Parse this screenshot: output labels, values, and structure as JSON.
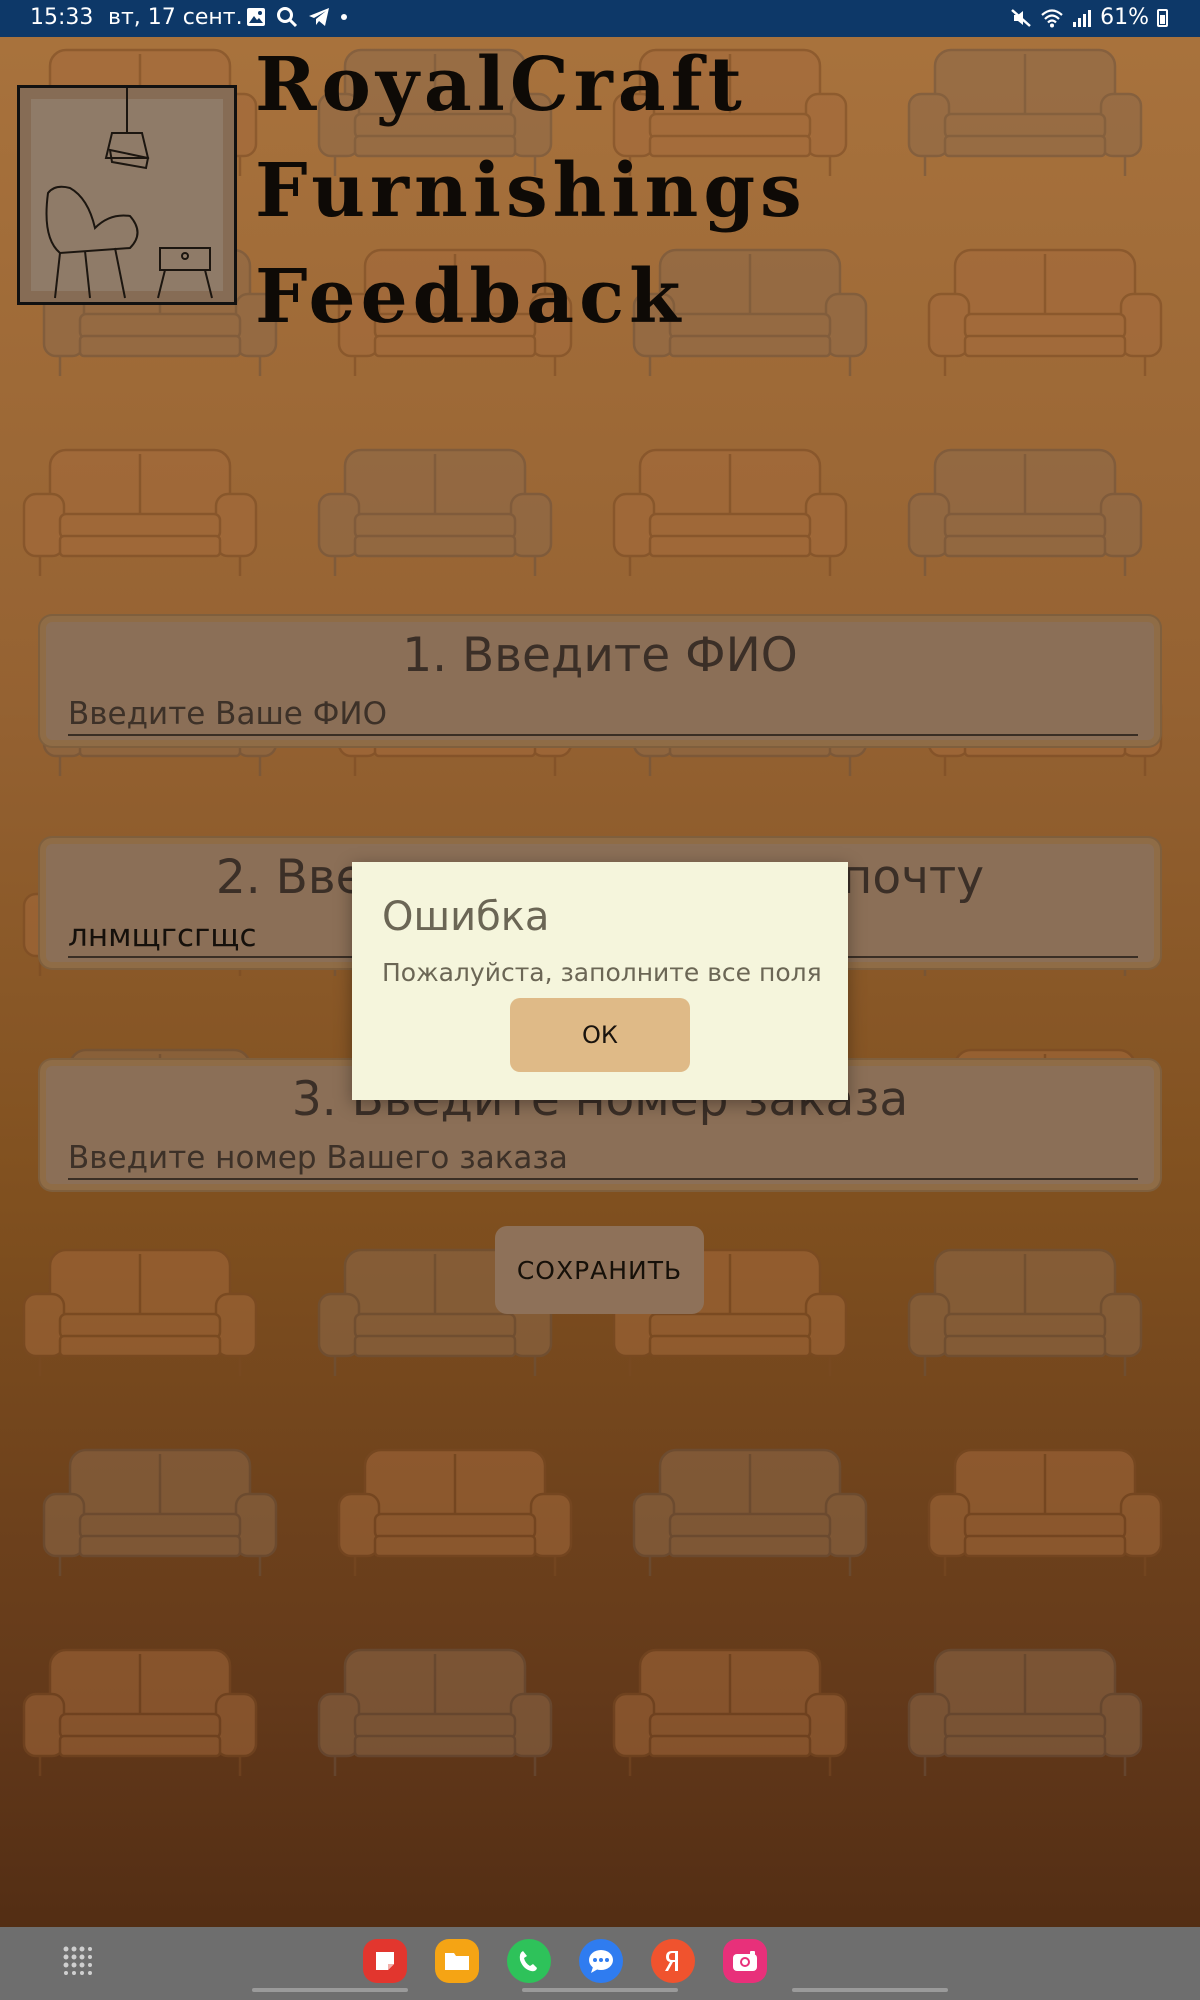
{
  "status_bar": {
    "time": "15:33",
    "date": "вт, 17 сент.",
    "battery_percent": "61%"
  },
  "header": {
    "title_line_1": "RoyalCraft",
    "title_line_2": "Furnishings",
    "title_line_3": "Feedback"
  },
  "form": {
    "q1": {
      "label": "1. Введите ФИО",
      "placeholder": "Введите Ваше ФИО",
      "value": ""
    },
    "q2": {
      "label": "2. Введите электронную почту",
      "placeholder": "",
      "value": "лнмщгсгщс"
    },
    "q3": {
      "label": "3. Введите номер заказа",
      "placeholder": "Введите номер Вашего заказа",
      "value": ""
    },
    "save_label": "СОХРАНИТЬ"
  },
  "dialog": {
    "title": "Ошибка",
    "message": "Пожалуйста, заполните все поля",
    "ok_label": "ОК"
  },
  "colors": {
    "status_bar": "#0d3868",
    "background_top": "#a9733d",
    "background_bottom": "#4e2a12",
    "card": "#8b6f57",
    "dialog_bg": "#f5f5dc",
    "ok_button": "#dfba87"
  },
  "nav": {
    "dock_icons": [
      "notes-icon",
      "files-icon",
      "phone-icon",
      "messages-icon",
      "yandex-icon",
      "camera-icon"
    ]
  }
}
